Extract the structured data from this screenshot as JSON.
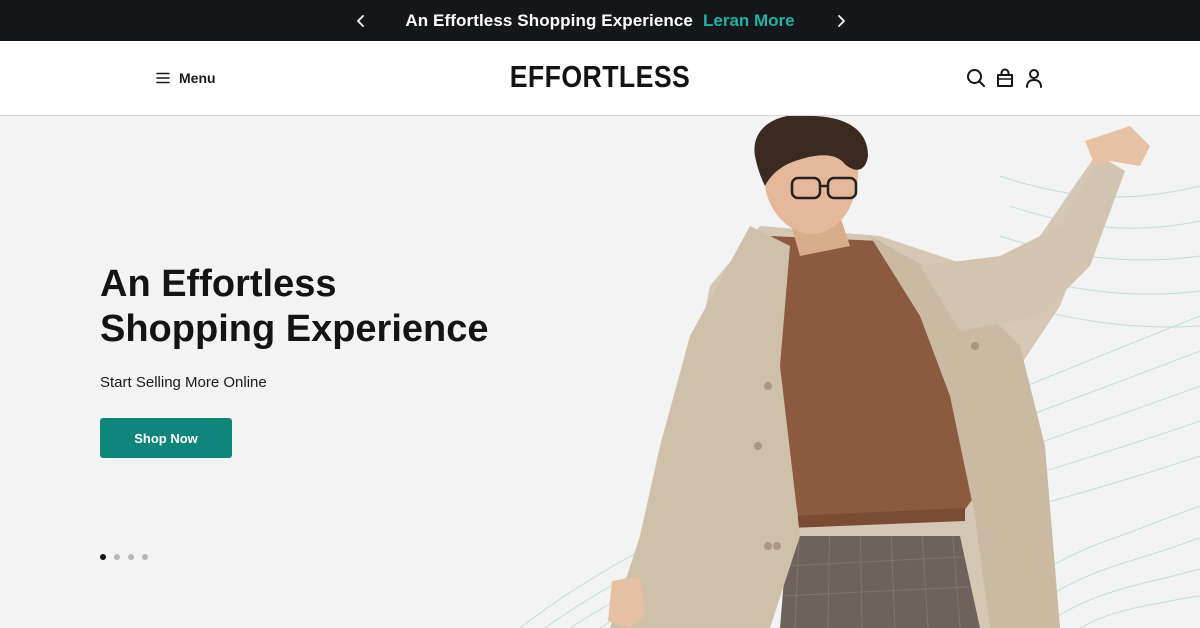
{
  "announcement": {
    "text": "An Effortless Shopping Experience",
    "link": "Leran More",
    "prev_icon": "chevron-left-icon",
    "next_icon": "chevron-right-icon"
  },
  "header": {
    "menu_label": "Menu",
    "logo": "EFFORTLESS",
    "icons": [
      "search-icon",
      "shopping-bag-icon",
      "user-icon"
    ]
  },
  "hero": {
    "title_line1": "An Effortless",
    "title_line2": "Shopping Experience",
    "subtitle": "Start Selling More Online",
    "button": "Shop Now",
    "slide_count": 4,
    "active_slide": 1
  },
  "colors": {
    "announcement_bg": "#16171b",
    "accent": "#1eb3a6",
    "button": "#0f857b",
    "hero_bg": "#f3f3f3"
  }
}
